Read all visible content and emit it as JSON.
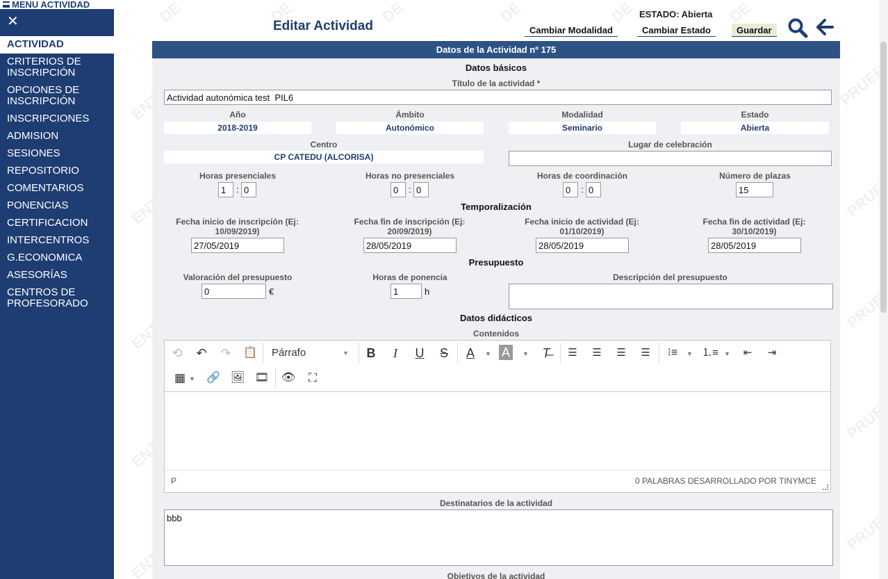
{
  "sidebar": {
    "menu_title": "MENU ACTIVIDAD",
    "close_symbol": "✕",
    "items": [
      {
        "label": "ACTIVIDAD",
        "active": true
      },
      {
        "label": "CRITERIOS DE INSCRIPCIÓN"
      },
      {
        "label": "OPCIONES DE INSCRIPCIÓN"
      },
      {
        "label": "INSCRIPCIONES"
      },
      {
        "label": "ADMISION"
      },
      {
        "label": "SESIONES"
      },
      {
        "label": "REPOSITORIO"
      },
      {
        "label": "COMENTARIOS"
      },
      {
        "label": "PONENCIAS"
      },
      {
        "label": "CERTIFICACION"
      },
      {
        "label": "INTERCENTROS"
      },
      {
        "label": "G.ECONOMICA"
      },
      {
        "label": "ASESORÍAS"
      },
      {
        "label": "CENTROS DE PROFESORADO"
      }
    ]
  },
  "header": {
    "title": "Editar Actividad",
    "estado": "ESTADO: Abierta",
    "buttons": {
      "cambiar_modalidad": "Cambiar Modalidad",
      "cambiar_estado": "Cambiar Estado",
      "guardar": "Guardar"
    },
    "icons": [
      "search-icon",
      "arrow-left-icon"
    ]
  },
  "form": {
    "panel_title": "Datos de la Actividad nº 175",
    "datos_basicos": {
      "section": "Datos básicos",
      "titulo_label": "Título de la actividad *",
      "titulo_value": "Actividad autonómica test  PIL6",
      "anio_label": "Año",
      "anio_value": "2018-2019",
      "ambito_label": "Ámbito",
      "ambito_value": "Autonómico",
      "modalidad_label": "Modalidad",
      "modalidad_value": "Seminario",
      "estado_label": "Estado",
      "estado_value": "Abierta",
      "centro_label": "Centro",
      "centro_value": "CP CATEDU (ALCORISA)",
      "lugar_label": "Lugar de celebración",
      "lugar_value": "",
      "horas_presenciales_label": "Horas presenciales",
      "horas_presenciales_h": "1",
      "horas_presenciales_m": "0",
      "horas_no_presenciales_label": "Horas no presenciales",
      "horas_no_presenciales_h": "0",
      "horas_no_presenciales_m": "0",
      "horas_coordinacion_label": "Horas de coordinación",
      "horas_coordinacion_h": "0",
      "horas_coordinacion_m": "0",
      "plazas_label": "Número de plazas",
      "plazas_value": "15",
      "time_sep": ":"
    },
    "temporalizacion": {
      "section": "Temporalización",
      "inicio_insc_label": "Fecha inicio de inscripción (Ej: 10/09/2019)",
      "inicio_insc_value": "27/05/2019",
      "fin_insc_label": "Fecha fin de inscripción (Ej: 20/09/2019)",
      "fin_insc_value": "28/05/2019",
      "inicio_act_label": "Fecha inicio de actividad (Ej: 01/10/2019)",
      "inicio_act_value": "28/05/2019",
      "fin_act_label": "Fecha fin de actividad (Ej: 30/10/2019)",
      "fin_act_value": "28/05/2019"
    },
    "presupuesto": {
      "section": "Presupuesto",
      "valoracion_label": "Valoración del presupuesto",
      "valoracion_value": "0",
      "valoracion_unit": "€",
      "horas_ponencia_label": "Horas de ponencia",
      "horas_ponencia_value": "1",
      "horas_ponencia_unit": "h",
      "descripcion_label": "Descripción del presupuesto",
      "descripcion_value": ""
    },
    "datos_didacticos": {
      "section": "Datos didácticos",
      "contenidos_label": "Contenidos",
      "editor": {
        "format_select": "Párrafo",
        "path": "P",
        "status": "0 PALABRAS DESARROLLADO POR TINYMCE"
      },
      "destinatarios_label": "Destinatarios de la actividad",
      "destinatarios_value": "bbb",
      "objetivos_label": "Objetivos de la actividad"
    }
  },
  "watermark": [
    "ENTORNO",
    "DE",
    "PRUEBAS"
  ]
}
